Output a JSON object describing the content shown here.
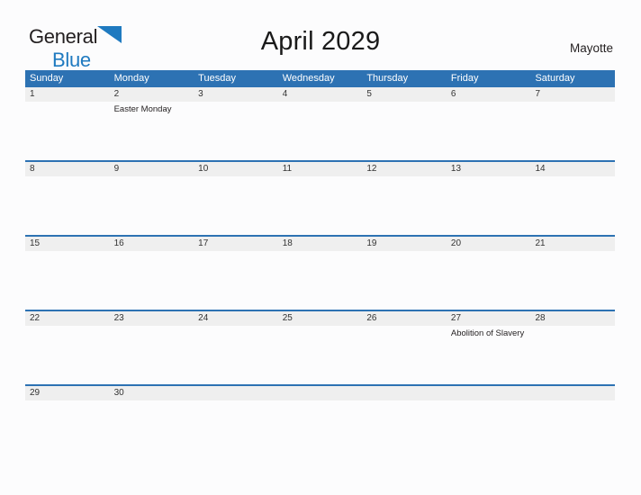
{
  "brand": {
    "name_part1": "General",
    "name_part2": "Blue",
    "logo_icon": "blue-triangle-icon",
    "accent_color": "#1f7ac0"
  },
  "header": {
    "title": "April 2029",
    "location": "Mayotte"
  },
  "theme": {
    "header_blue": "#2d72b3",
    "date_band_gray": "#efefef",
    "separator_blue": "#2d72b3",
    "page_background": "#fcfcfd",
    "text_color": "#231f20"
  },
  "calendar": {
    "weekdays": [
      "Sunday",
      "Monday",
      "Tuesday",
      "Wednesday",
      "Thursday",
      "Friday",
      "Saturday"
    ],
    "weeks": [
      {
        "days": [
          {
            "date": "1",
            "events": []
          },
          {
            "date": "2",
            "events": [
              "Easter Monday"
            ]
          },
          {
            "date": "3",
            "events": []
          },
          {
            "date": "4",
            "events": []
          },
          {
            "date": "5",
            "events": []
          },
          {
            "date": "6",
            "events": []
          },
          {
            "date": "7",
            "events": []
          }
        ]
      },
      {
        "days": [
          {
            "date": "8",
            "events": []
          },
          {
            "date": "9",
            "events": []
          },
          {
            "date": "10",
            "events": []
          },
          {
            "date": "11",
            "events": []
          },
          {
            "date": "12",
            "events": []
          },
          {
            "date": "13",
            "events": []
          },
          {
            "date": "14",
            "events": []
          }
        ]
      },
      {
        "days": [
          {
            "date": "15",
            "events": []
          },
          {
            "date": "16",
            "events": []
          },
          {
            "date": "17",
            "events": []
          },
          {
            "date": "18",
            "events": []
          },
          {
            "date": "19",
            "events": []
          },
          {
            "date": "20",
            "events": []
          },
          {
            "date": "21",
            "events": []
          }
        ]
      },
      {
        "days": [
          {
            "date": "22",
            "events": []
          },
          {
            "date": "23",
            "events": []
          },
          {
            "date": "24",
            "events": []
          },
          {
            "date": "25",
            "events": []
          },
          {
            "date": "26",
            "events": []
          },
          {
            "date": "27",
            "events": [
              "Abolition of Slavery"
            ]
          },
          {
            "date": "28",
            "events": []
          }
        ]
      },
      {
        "days": [
          {
            "date": "29",
            "events": []
          },
          {
            "date": "30",
            "events": []
          },
          {
            "date": "",
            "events": []
          },
          {
            "date": "",
            "events": []
          },
          {
            "date": "",
            "events": []
          },
          {
            "date": "",
            "events": []
          },
          {
            "date": "",
            "events": []
          }
        ]
      }
    ]
  }
}
